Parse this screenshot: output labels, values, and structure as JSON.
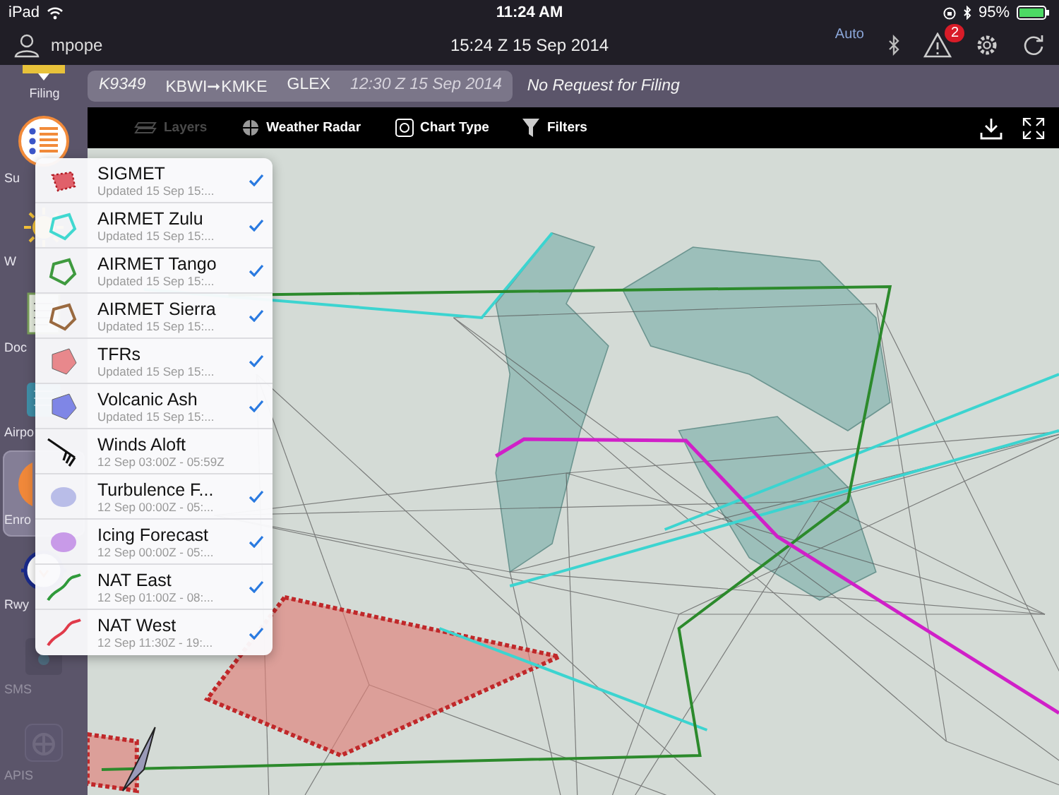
{
  "status_bar": {
    "device": "iPad",
    "time": "11:24 AM",
    "battery": "95%"
  },
  "top_bar": {
    "user": "mpope",
    "datetime": "15:24 Z  15 Sep 2014",
    "mode": "Auto",
    "alerts_badge": "2"
  },
  "sidebar": {
    "items": [
      {
        "label": "Filing",
        "selected": false,
        "disabled": false
      },
      {
        "label": "Su",
        "selected": false,
        "disabled": false
      },
      {
        "label": "W",
        "selected": false,
        "disabled": false
      },
      {
        "label": "Doc",
        "selected": false,
        "disabled": false
      },
      {
        "label": "Airpo",
        "selected": false,
        "disabled": false
      },
      {
        "label": "Enro",
        "selected": true,
        "disabled": false
      },
      {
        "label": "Rwy",
        "selected": false,
        "disabled": false
      },
      {
        "label": "SMS",
        "selected": false,
        "disabled": true
      },
      {
        "label": "APIS",
        "selected": false,
        "disabled": true
      }
    ]
  },
  "flight_strip": {
    "flight": "K9349",
    "route": "KBWI➞KMKE",
    "aircraft": "GLEX",
    "departure": "12:30 Z 15 Sep 2014",
    "filing_status": "No Request for Filing"
  },
  "map_toolbar": {
    "tabs": [
      {
        "label": "Layers",
        "selected": true
      },
      {
        "label": "Weather Radar",
        "selected": false
      },
      {
        "label": "Chart Type",
        "selected": false
      },
      {
        "label": "Filters",
        "selected": false
      }
    ]
  },
  "layers": [
    {
      "name": "SIGMET",
      "subtitle": "Updated 15 Sep 15:...",
      "kind": "dotted",
      "color": "#e0606a",
      "checked": true
    },
    {
      "name": "AIRMET Zulu",
      "subtitle": "Updated 15 Sep 15:...",
      "kind": "outline",
      "color": "#40d8d0",
      "checked": true
    },
    {
      "name": "AIRMET Tango",
      "subtitle": "Updated 15 Sep 15:...",
      "kind": "outline",
      "color": "#3f9a3f",
      "checked": true
    },
    {
      "name": "AIRMET Sierra",
      "subtitle": "Updated 15 Sep 15:...",
      "kind": "outline",
      "color": "#9a6a40",
      "checked": true
    },
    {
      "name": "TFRs",
      "subtitle": "Updated 15 Sep 15:...",
      "kind": "filled",
      "color": "#e8888c",
      "checked": true
    },
    {
      "name": "Volcanic Ash",
      "subtitle": "Updated 15 Sep 15:...",
      "kind": "filled",
      "color": "#7f86e6",
      "checked": true
    },
    {
      "name": "Winds Aloft",
      "subtitle": "12 Sep 03:00Z - 05:59Z",
      "kind": "wind",
      "color": "#111111",
      "checked": false
    },
    {
      "name": "Turbulence F...",
      "subtitle": "12 Sep 00:00Z - 05:...",
      "kind": "blob",
      "color": "#b9bde8",
      "checked": true
    },
    {
      "name": "Icing Forecast",
      "subtitle": "12 Sep 00:00Z - 05:...",
      "kind": "blob",
      "color": "#c89ae8",
      "checked": true
    },
    {
      "name": "NAT East",
      "subtitle": "12 Sep 01:00Z - 08:...",
      "kind": "track",
      "color": "#2f9a3a",
      "checked": true
    },
    {
      "name": "NAT West",
      "subtitle": "12 Sep 11:30Z - 19:...",
      "kind": "track",
      "color": "#e03a4a",
      "checked": true
    }
  ]
}
